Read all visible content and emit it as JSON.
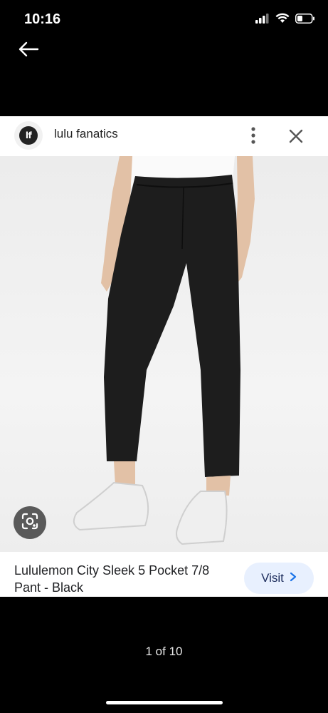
{
  "status": {
    "time": "10:16",
    "icons": [
      "signal-icon",
      "wifi-icon",
      "battery-icon"
    ]
  },
  "nav": {
    "back_icon": "arrow-left-icon"
  },
  "source": {
    "logo_text": "lf",
    "name": "lulu fanatics",
    "more_icon": "more-vertical-icon",
    "close_icon": "close-icon"
  },
  "product": {
    "title": "Lululemon City Sleek 5 Pocket 7/8 Pant - Black",
    "visit_label": "Visit",
    "lens_icon": "google-lens-icon"
  },
  "pager": {
    "text": "1 of 10"
  },
  "colors": {
    "background": "#000000",
    "visit_button": "#e8f0fe",
    "lens_button": "#5a5a5a"
  }
}
